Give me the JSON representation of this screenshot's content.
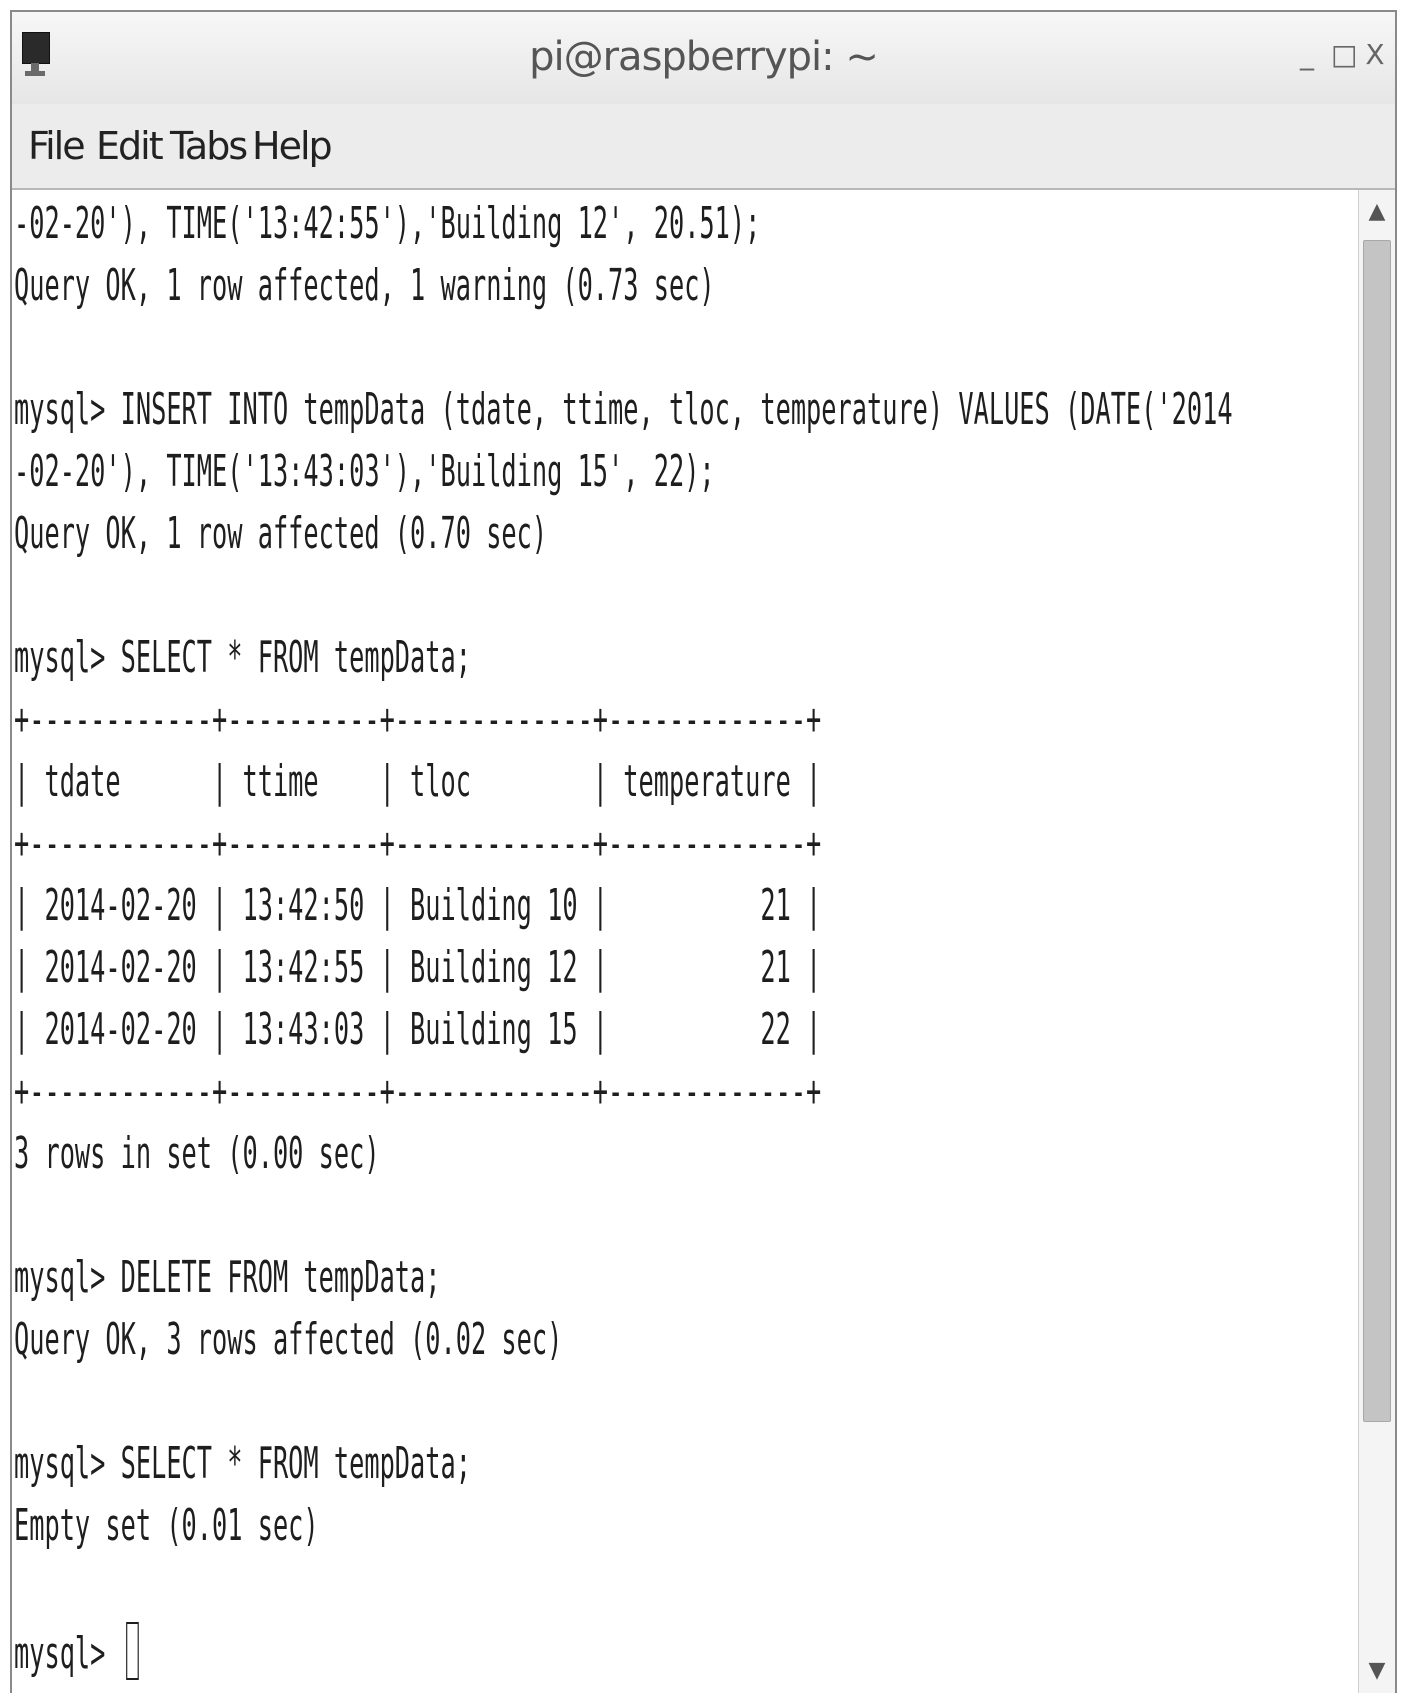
{
  "window": {
    "title": "pi@raspberrypi: ~",
    "controls": {
      "minimize": "_",
      "maximize": "□",
      "close": "X"
    }
  },
  "menu": {
    "items": [
      "File",
      "Edit",
      "Tabs",
      "Help"
    ]
  },
  "terminal": {
    "lines": [
      "-02-20'), TIME('13:42:55'),'Building 12', 20.51);",
      "Query OK, 1 row affected, 1 warning (0.73 sec)",
      "",
      "mysql> INSERT INTO tempData (tdate, ttime, tloc, temperature) VALUES (DATE('2014",
      "-02-20'), TIME('13:43:03'),'Building 15', 22);",
      "Query OK, 1 row affected (0.70 sec)",
      "",
      "mysql> SELECT * FROM tempData;",
      "+------------+----------+-------------+-------------+",
      "| tdate      | ttime    | tloc        | temperature |",
      "+------------+----------+-------------+-------------+",
      "| 2014-02-20 | 13:42:50 | Building 10 |          21 |",
      "| 2014-02-20 | 13:42:55 | Building 12 |          21 |",
      "| 2014-02-20 | 13:43:03 | Building 15 |          22 |",
      "+------------+----------+-------------+-------------+",
      "3 rows in set (0.00 sec)",
      "",
      "mysql> DELETE FROM tempData;",
      "Query OK, 3 rows affected (0.02 sec)",
      "",
      "mysql> SELECT * FROM tempData;",
      "Empty set (0.01 sec)",
      "",
      "mysql> "
    ]
  },
  "scrollbar": {
    "up_arrow": "▲",
    "down_arrow": "▼"
  }
}
